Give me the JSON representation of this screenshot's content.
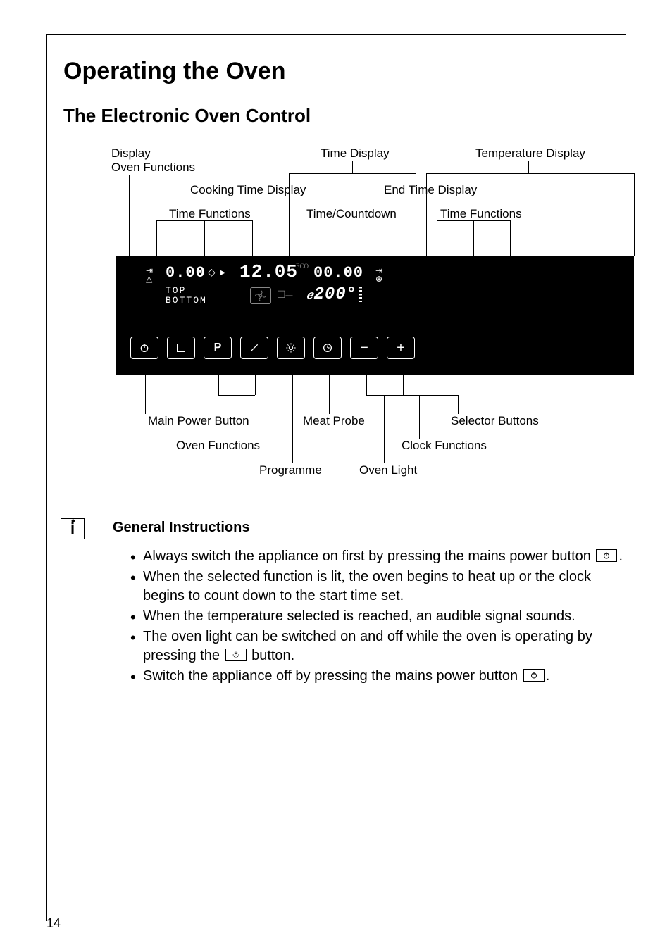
{
  "page_number": "14",
  "title": "Operating the Oven",
  "subtitle": "The Electronic Oven Control",
  "labels": {
    "top": {
      "display_functions_l1": "Display",
      "display_functions_l2": "Oven Functions",
      "time_display": "Time Display",
      "temp_display": "Temperature Display",
      "cooking_time_display": "Cooking Time Display",
      "end_time_display": "End Time Display",
      "time_functions_left": "Time Functions",
      "time_countdown": "Time/Countdown",
      "time_functions_right": "Time Functions"
    },
    "bottom": {
      "main_power": "Main Power Button",
      "oven_functions": "Oven Functions",
      "programme": "Programme",
      "meat_probe": "Meat Probe",
      "oven_light": "Oven Light",
      "clock_functions": "Clock Functions",
      "selector_buttons": "Selector Buttons"
    }
  },
  "display_values": {
    "cooking_time": "0.00",
    "clock": "12.05",
    "end_time": "00.00",
    "temp": "200°",
    "mode_line1": "TOP",
    "mode_line2": "BOTTOM",
    "eco": "ECO"
  },
  "buttons": {
    "p_label": "P",
    "minus": "−",
    "plus": "+"
  },
  "general_instructions_header": "General Instructions",
  "instructions": {
    "i1a": "Always switch the appliance on first by pressing the mains power button ",
    "i1b": ".",
    "i2": "When the selected function is lit, the oven begins to heat up or the clock begins to count down to the start time set.",
    "i3": "When the temperature selected is reached, an audible signal sounds.",
    "i4a": "The oven light can be switched on and off while the oven is operating by pressing the ",
    "i4b": " button.",
    "i5a": "Switch the appliance off by pressing the mains power button ",
    "i5b": "."
  }
}
